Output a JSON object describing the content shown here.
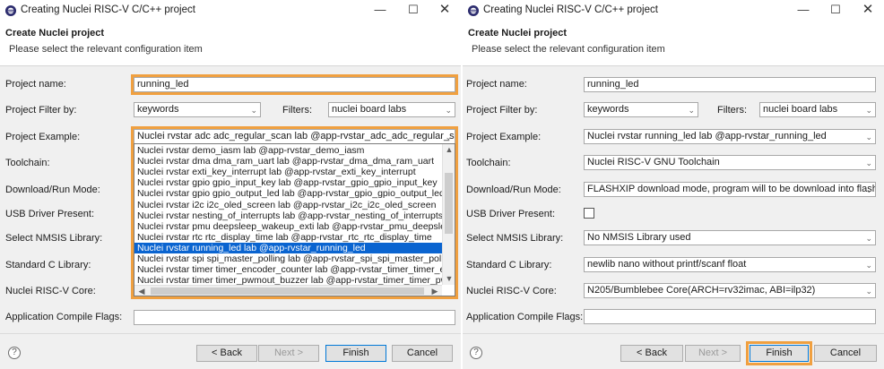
{
  "left": {
    "title": "Creating Nuclei RISC-V C/C++ project",
    "header_title": "Create Nuclei project",
    "header_sub": "Please select the relevant configuration item",
    "project_name_label": "Project name:",
    "project_name_value": "running_led",
    "filter_label": "Project Filter by:",
    "filter_value": "keywords",
    "filters_label": "Filters:",
    "filters_value": "nuclei board labs",
    "example_label": "Project Example:",
    "example_value": "Nuclei rvstar adc adc_regular_scan lab  @app-rvstar_adc_adc_regular_scan",
    "toolchain_label": "Toolchain:",
    "download_label": "Download/Run Mode:",
    "usb_label": "USB Driver Present:",
    "nmsis_label": "Select NMSIS Library:",
    "stdc_label": "Standard C Library:",
    "core_label": "Nuclei RISC-V Core:",
    "compile_label": "Application Compile Flags:",
    "dropdown_items": [
      "Nuclei rvstar demo_iasm lab  @app-rvstar_demo_iasm",
      "Nuclei rvstar dma dma_ram_uart lab  @app-rvstar_dma_dma_ram_uart",
      "Nuclei rvstar exti_key_interrupt lab  @app-rvstar_exti_key_interrupt",
      "Nuclei rvstar gpio gpio_input_key lab  @app-rvstar_gpio_gpio_input_key",
      "Nuclei rvstar gpio gpio_output_led lab  @app-rvstar_gpio_gpio_output_led",
      "Nuclei rvstar i2c i2c_oled_screen lab  @app-rvstar_i2c_i2c_oled_screen",
      "Nuclei rvstar nesting_of_interrupts lab  @app-rvstar_nesting_of_interrupts",
      "Nuclei rvstar pmu deepsleep_wakeup_exti lab  @app-rvstar_pmu_deepsleep_wakeup_exti",
      "Nuclei rvstar rtc rtc_display_time lab  @app-rvstar_rtc_rtc_display_time",
      "Nuclei rvstar running_led lab  @app-rvstar_running_led",
      "Nuclei rvstar spi spi_master_polling lab  @app-rvstar_spi_spi_master_polling",
      "Nuclei rvstar timer timer_encoder_counter lab  @app-rvstar_timer_timer_encoder_counter",
      "Nuclei rvstar timer timer_pwmout_buzzer lab  @app-rvstar_timer_timer_pwmout_buzzer"
    ],
    "selected_item_index": 9,
    "back": "< Back",
    "next": "Next >",
    "finish": "Finish",
    "cancel": "Cancel"
  },
  "right": {
    "title": "Creating Nuclei RISC-V C/C++ project",
    "header_title": "Create Nuclei project",
    "header_sub": "Please select the relevant configuration item",
    "project_name_label": "Project name:",
    "project_name_value": "running_led",
    "filter_label": "Project Filter by:",
    "filter_value": "keywords",
    "filters_label": "Filters:",
    "filters_value": "nuclei board labs",
    "example_label": "Project Example:",
    "example_value": "Nuclei rvstar running_led lab  @app-rvstar_running_led",
    "toolchain_label": "Toolchain:",
    "toolchain_value": "Nuclei RISC-V GNU Toolchain",
    "download_label": "Download/Run Mode:",
    "download_value": "FLASHXIP download mode, program will to be download into flash and",
    "usb_label": "USB Driver Present:",
    "usb_checked": false,
    "nmsis_label": "Select NMSIS Library:",
    "nmsis_value": "No NMSIS Library used",
    "stdc_label": "Standard C Library:",
    "stdc_value": "newlib nano without printf/scanf float",
    "core_label": "Nuclei RISC-V Core:",
    "core_value": "N205/Bumblebee Core(ARCH=rv32imac, ABI=ilp32)",
    "compile_label": "Application Compile Flags:",
    "back": "< Back",
    "next": "Next >",
    "finish": "Finish",
    "cancel": "Cancel"
  },
  "colors": {
    "highlight": "#f0a040",
    "selection": "#0a64d0",
    "default_button_border": "#0078d7"
  },
  "icons": {
    "app": "nuclei-eclipse-icon",
    "minimize": "minimize-icon",
    "maximize": "maximize-icon",
    "close": "close-icon",
    "help": "help-icon",
    "chevron": "chevron-down-icon"
  }
}
